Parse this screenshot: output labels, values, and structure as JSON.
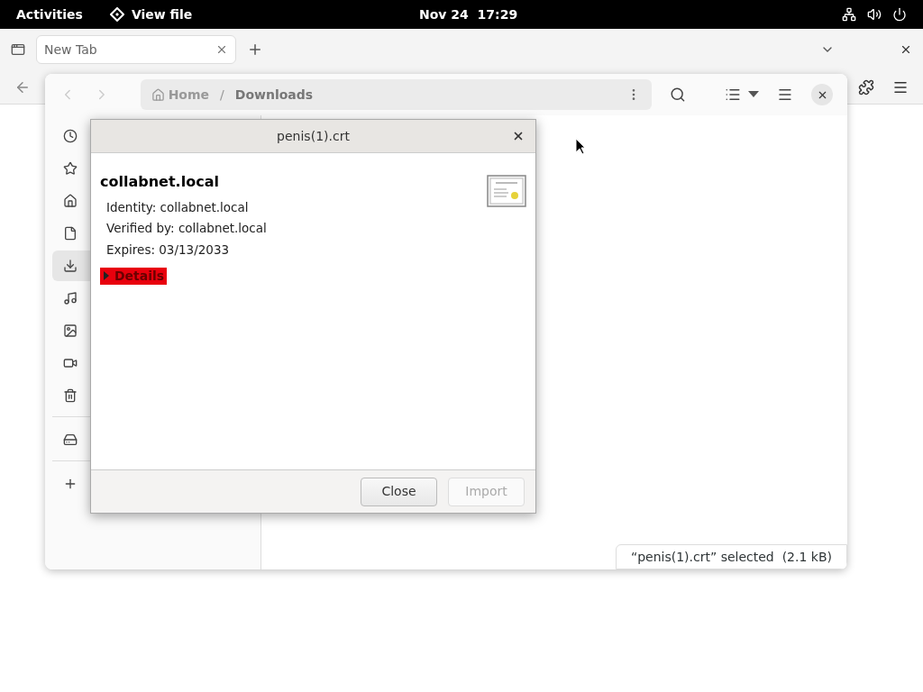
{
  "top_bar": {
    "activities": "Activities",
    "app": "View file",
    "clock": "Nov 24  17:29"
  },
  "browser": {
    "tabs": [
      {
        "label": "New Tab",
        "selected": true
      }
    ]
  },
  "file_chooser": {
    "path": [
      {
        "label": "Home"
      },
      {
        "separator": "/",
        "label": "Downloads"
      }
    ],
    "sidebar_groups": [
      {
        "items": [
          {
            "selected": false
          },
          {
            "selected": false
          },
          {
            "selected": false
          },
          {
            "selected": false
          },
          {
            "selected": true
          },
          {
            "selected": false
          },
          {
            "selected": false
          },
          {
            "selected": false
          },
          {
            "selected": false
          }
        ]
      },
      {
        "items": [
          {
            "selected": false
          }
        ]
      },
      {
        "items": [
          {
            "selected": false
          }
        ]
      }
    ],
    "status": "“penis(1).crt” selected  (2.1 kB)"
  },
  "dialog": {
    "title": "penis(1).crt",
    "heading": "collabnet.local",
    "lines": [
      "Identity: collabnet.local",
      "Verified by: collabnet.local",
      "Expires: 03/13/2033"
    ],
    "details": {
      "label": "Details",
      "expanded": false,
      "focused": true
    },
    "buttons": [
      {
        "label": "Close",
        "disabled": false
      },
      {
        "label": "Import",
        "disabled": true
      }
    ]
  }
}
